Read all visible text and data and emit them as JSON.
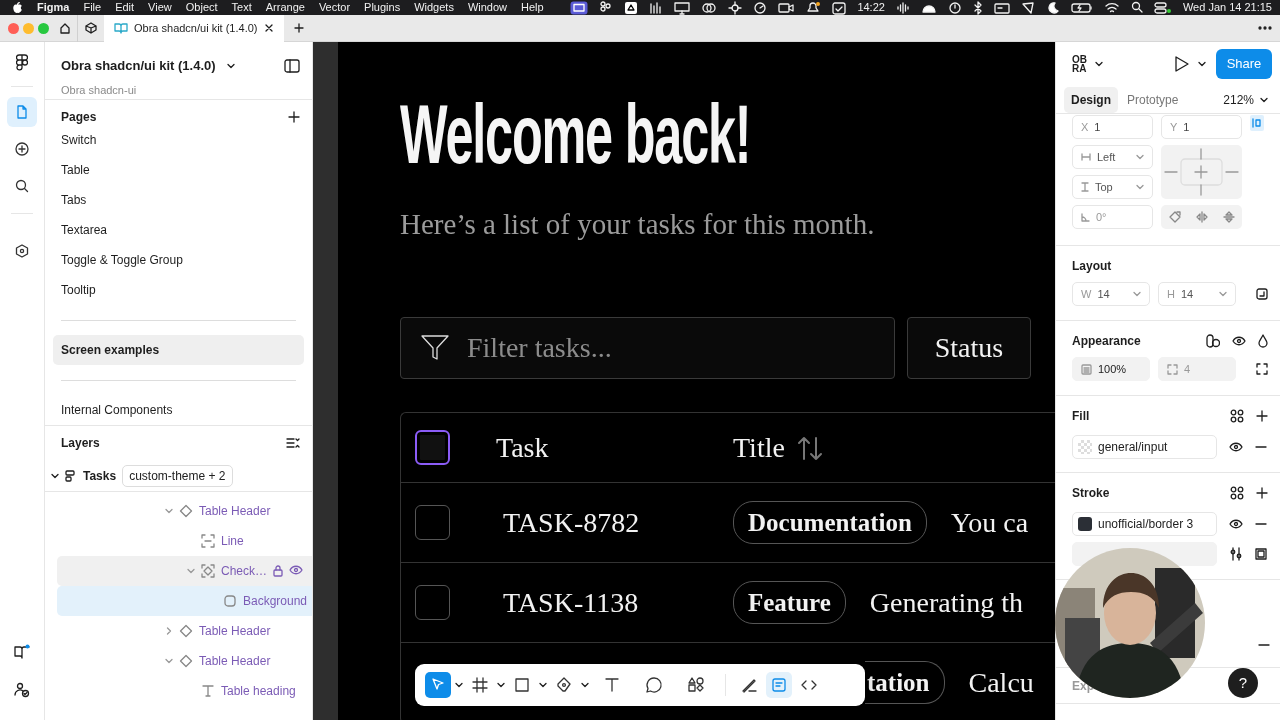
{
  "menubar": {
    "app": "Figma",
    "menus": [
      "File",
      "Edit",
      "View",
      "Object",
      "Text",
      "Arrange",
      "Vector",
      "Plugins",
      "Widgets",
      "Window",
      "Help"
    ],
    "timer": "14:22",
    "clock": "Wed Jan 14 21:15"
  },
  "browser_tabs": [
    {
      "label": "Obra shadcn/ui kit (1.4.0)",
      "selected": true
    }
  ],
  "left_rail": [
    {
      "kind": "file",
      "selected": true
    },
    {
      "kind": "assets",
      "selected": false
    },
    {
      "kind": "search",
      "selected": false
    },
    {
      "kind": "plugins",
      "selected": false
    }
  ],
  "resources_badge": true,
  "file": {
    "name": "Obra shadcn/ui kit (1.4.0)",
    "team": "Obra shadcn-ui"
  },
  "pages": {
    "title": "Pages",
    "items": [
      {
        "kind": "page",
        "label": "Switch",
        "selected": false
      },
      {
        "kind": "page",
        "label": "Table",
        "selected": false
      },
      {
        "kind": "page",
        "label": "Tabs",
        "selected": false
      },
      {
        "kind": "page",
        "label": "Textarea",
        "selected": false
      },
      {
        "kind": "page",
        "label": "Toggle & Toggle Group",
        "selected": false
      },
      {
        "kind": "page",
        "label": "Tooltip",
        "selected": false
      },
      {
        "kind": "divider"
      },
      {
        "kind": "page",
        "label": "Screen examples",
        "selected": true
      },
      {
        "kind": "divider"
      },
      {
        "kind": "page",
        "label": "Internal Components",
        "selected": false
      }
    ]
  },
  "layers": {
    "title": "Layers",
    "root": {
      "name": "Tasks",
      "tag": "custom-theme + 2",
      "expanded": true
    },
    "items": [
      {
        "name": "Table Header",
        "kind": "component",
        "expanded": true,
        "selected": false,
        "hovered": false,
        "children": [
          {
            "name": "Line",
            "kind": "line",
            "selected": false,
            "hovered": false
          },
          {
            "name": "Check…",
            "kind": "instance",
            "expanded": true,
            "selected": false,
            "hovered": true,
            "children": [
              {
                "name": "Background",
                "kind": "rectangle",
                "selected": true,
                "hovered": false
              }
            ]
          }
        ]
      },
      {
        "name": "Table Header",
        "kind": "component",
        "expanded": false,
        "selected": false,
        "hovered": false
      },
      {
        "name": "Table Header",
        "kind": "component",
        "expanded": true,
        "selected": false,
        "hovered": false,
        "children": [
          {
            "name": "Table heading",
            "kind": "text",
            "selected": false,
            "hovered": false
          }
        ]
      }
    ]
  },
  "canvas": {
    "heading": "Welcome back!",
    "subheading": "Here’s a list of your tasks for this month.",
    "filter": {
      "placeholder": "Filter tasks..."
    },
    "status_button": "Status",
    "table": {
      "columns": [
        "Task",
        "Title"
      ],
      "header_checkbox": {
        "checked": false,
        "selected": true
      },
      "rows": [
        {
          "checked": false,
          "selected": false,
          "task": "TASK-8782",
          "label": "Documentation",
          "title": "You ca"
        },
        {
          "checked": false,
          "selected": false,
          "task": "TASK-1138",
          "label": "Feature",
          "title": "Generating th"
        },
        {
          "label": "tation",
          "title": "Calcu"
        }
      ]
    }
  },
  "toolbar": {
    "tools": [
      {
        "kind": "move",
        "selected": true,
        "menu": true
      },
      {
        "kind": "frame",
        "selected": false,
        "menu": true
      },
      {
        "kind": "rectangle",
        "selected": false,
        "menu": true
      },
      {
        "kind": "pen",
        "selected": false,
        "menu": true
      },
      {
        "kind": "text",
        "selected": false
      },
      {
        "kind": "comment",
        "selected": false
      },
      {
        "kind": "actions",
        "selected": false
      }
    ],
    "modes": [
      {
        "kind": "draw",
        "selected": false
      },
      {
        "kind": "design",
        "selected": true
      },
      {
        "kind": "dev",
        "selected": false
      }
    ]
  },
  "right_panel": {
    "logo": "OBRA",
    "share": "Share",
    "tabs": [
      {
        "label": "Design",
        "selected": true
      },
      {
        "label": "Prototype",
        "selected": false
      }
    ],
    "zoom": "212%",
    "position": {
      "x": {
        "label": "X",
        "value": "1"
      },
      "y": {
        "label": "Y",
        "value": "1"
      },
      "horizontal": "Left",
      "vertical": "Top",
      "rotation": "0°"
    },
    "layout": {
      "title": "Layout",
      "width": {
        "label": "W",
        "value": "14"
      },
      "height": {
        "label": "H",
        "value": "14"
      }
    },
    "appearance": {
      "title": "Appearance",
      "opacity": "100%",
      "radius": "4"
    },
    "fill": {
      "title": "Fill",
      "items": [
        {
          "name": "general/input",
          "kind": "transparent"
        }
      ]
    },
    "stroke": {
      "title": "Stroke",
      "items": [
        {
          "name": "unofficial/border 3",
          "kind": "solid",
          "color": "#2b2f36"
        }
      ]
    },
    "export": {
      "title": "Exp"
    }
  },
  "help": "?"
}
